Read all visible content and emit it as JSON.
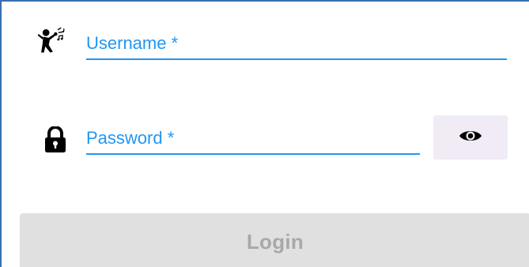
{
  "form": {
    "username": {
      "label": "Username *",
      "value": "",
      "icon": "singer-icon"
    },
    "password": {
      "label": "Password *",
      "value": "",
      "icon": "lock-icon",
      "toggle_icon": "eye-icon"
    },
    "login_button": {
      "label": "Login",
      "enabled": false
    }
  },
  "colors": {
    "accent": "#2196f3",
    "toggle_bg": "#f1ebf6",
    "disabled_bg": "#e0e0e0",
    "disabled_text": "#a8a8a8",
    "frame_border": "#3a6fb0"
  }
}
